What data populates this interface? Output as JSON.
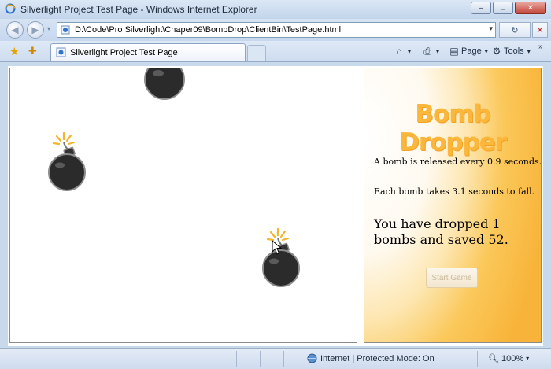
{
  "window": {
    "title": "Silverlight Project Test Page - Windows Internet Explorer",
    "minimize_glyph": "–",
    "maximize_glyph": "□",
    "close_glyph": "✕"
  },
  "address_bar": {
    "url": "D:\\Code\\Pro Silverlight\\Chaper09\\BombDrop\\ClientBin\\TestPage.html",
    "back_glyph": "◀",
    "forward_glyph": "▶",
    "refresh_glyph": "↻",
    "dropdown_glyph": "▾",
    "go_glyph": "✕"
  },
  "tabs": [
    {
      "label": "Silverlight Project Test Page"
    }
  ],
  "command_bar": {
    "home_glyph": "⌂",
    "print_glyph": "⎙",
    "page_label": "Page",
    "tools_label": "Tools",
    "dropdown_glyph": "▾",
    "overflow_glyph": "»"
  },
  "game": {
    "bombs": [
      {
        "id": "bomb-1",
        "lit": false
      },
      {
        "id": "bomb-2",
        "lit": true
      },
      {
        "id": "bomb-3",
        "lit": true
      }
    ]
  },
  "info": {
    "title": "Bomb Dropper",
    "release_text": "A bomb is released every 0.9 seconds.",
    "fall_text": "Each bomb takes 3.1 seconds to fall.",
    "status_text": "You have dropped 1 bombs and saved 52.",
    "start_button_label": "Start Game",
    "start_button_enabled": false
  },
  "status_bar": {
    "zone_text": "Internet | Protected Mode: On",
    "zoom_text": "100%",
    "zoom_dropdown_glyph": "▾"
  },
  "colors": {
    "title_orange": "#fbb73c",
    "panel_gradient_end": "#f8b43a"
  }
}
